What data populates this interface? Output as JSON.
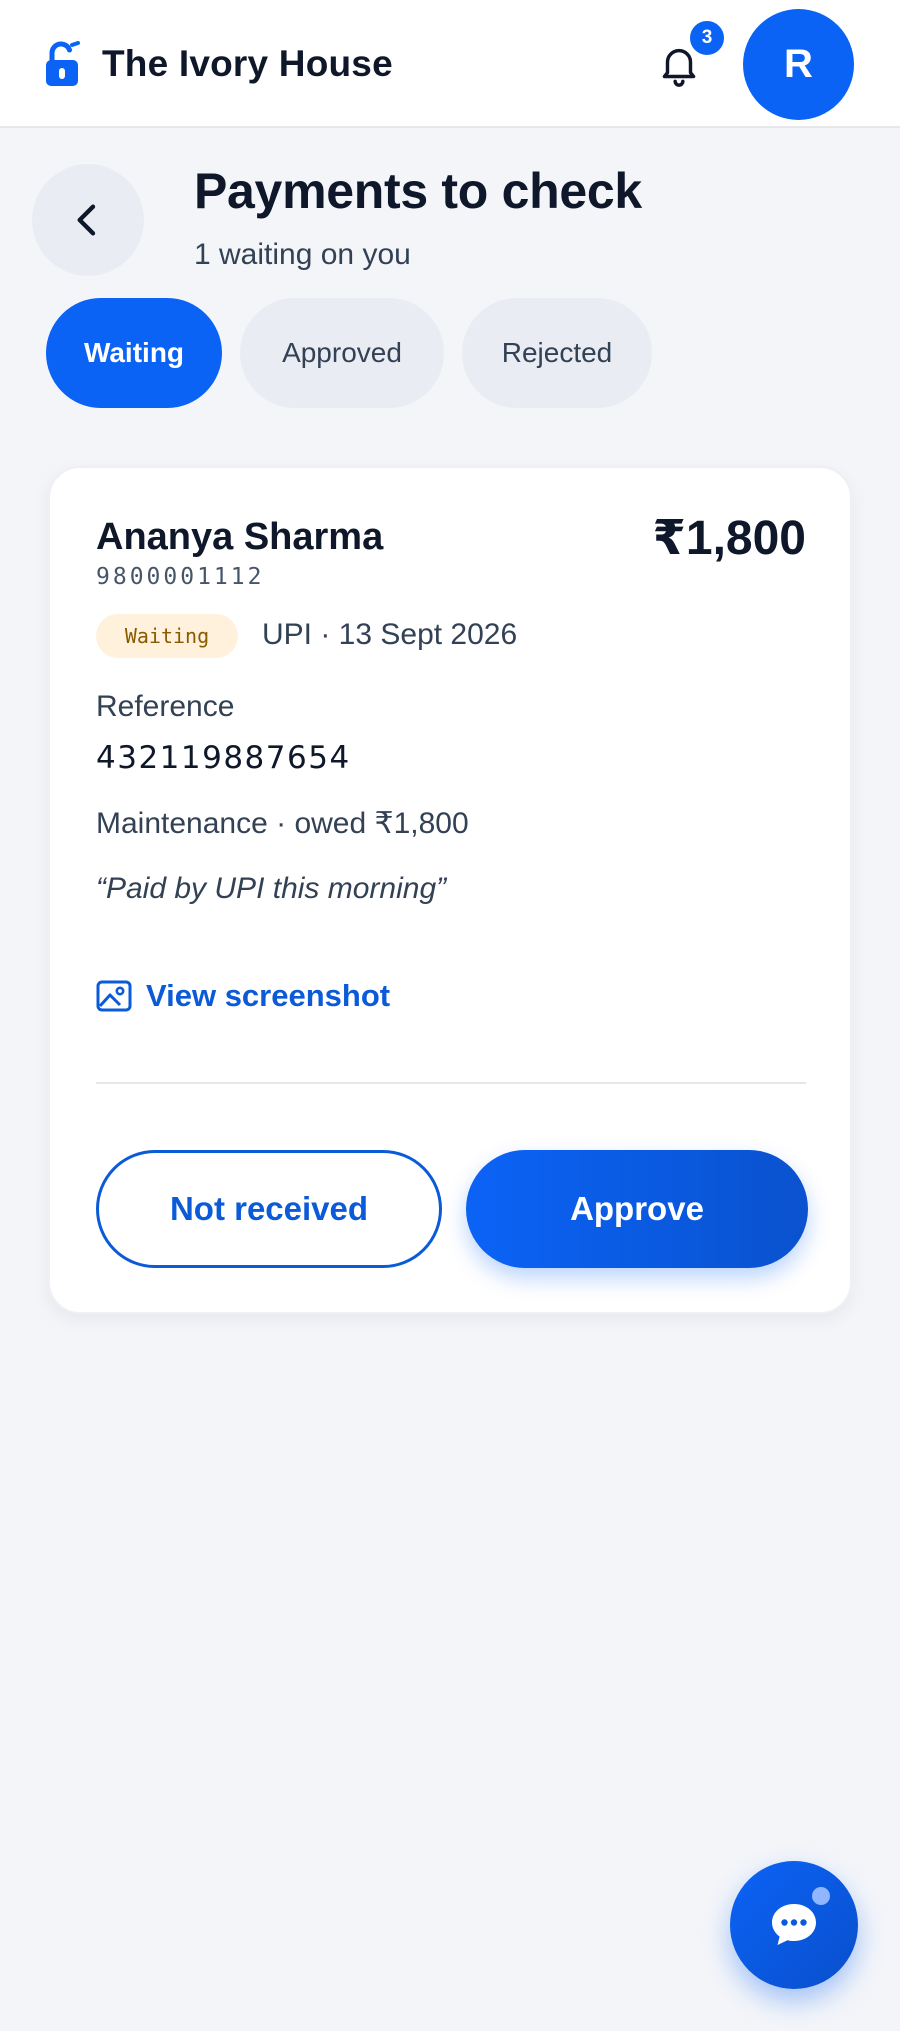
{
  "header": {
    "app_name": "The Ivory House",
    "notification_count": "3",
    "avatar_initial": "R"
  },
  "page": {
    "title": "Payments to check",
    "subtitle": "1 waiting on you"
  },
  "tabs": [
    {
      "label": "Waiting",
      "active": true
    },
    {
      "label": "Approved",
      "active": false
    },
    {
      "label": "Rejected",
      "active": false
    }
  ],
  "payment": {
    "name": "Ananya Sharma",
    "phone": "9800001112",
    "amount": "₹1,800",
    "status": "Waiting",
    "method_date": "UPI · 13 Sept 2026",
    "reference_label": "Reference",
    "reference_value": "432119887654",
    "due_line": "Maintenance · owed ₹1,800",
    "note": "“Paid by UPI this morning”",
    "view_label": "View screenshot",
    "reject_label": "Not received",
    "approve_label": "Approve"
  },
  "colors": {
    "accent": "#0b63f6",
    "link": "#0b5ad8",
    "badge_bg": "#fff1dc",
    "badge_text": "#8a5a00",
    "page_bg": "#f3f5f9"
  },
  "icons": {
    "brand": "padlock-open-icon",
    "notifications": "bell-icon",
    "back": "chevron-left-icon",
    "screenshot": "image-icon",
    "chat": "chat-bubble-icon"
  }
}
